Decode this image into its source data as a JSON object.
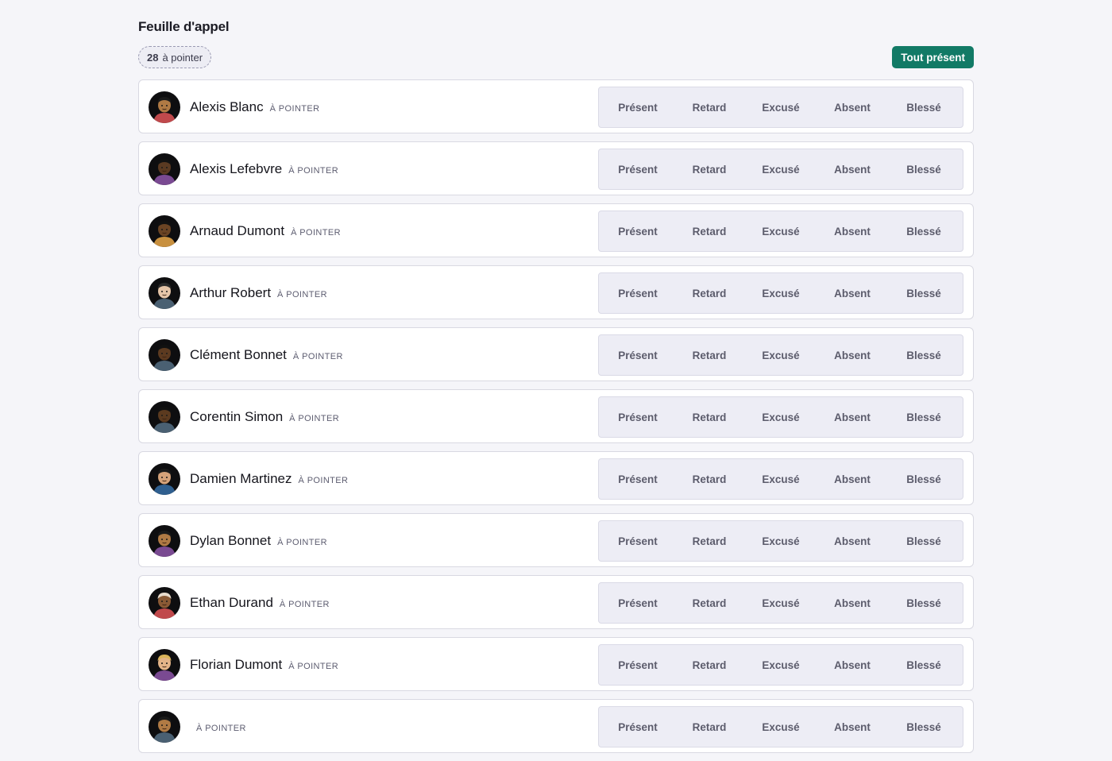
{
  "header": {
    "title": "Feuille d'appel",
    "count": "28",
    "count_label": "à pointer",
    "all_present_label": "Tout présent"
  },
  "status_options": [
    "Présent",
    "Retard",
    "Excusé",
    "Absent",
    "Blessé"
  ],
  "pending_tag": "À POINTER",
  "players": [
    {
      "name": "Alexis Blanc",
      "skin": "#b07a44",
      "shirt": "#c0494c",
      "hair": "#1a1a1a"
    },
    {
      "name": "Alexis Lefebvre",
      "skin": "#5a3a22",
      "shirt": "#7a4a92",
      "hair": "#111111"
    },
    {
      "name": "Arnaud Dumont",
      "skin": "#6b4424",
      "shirt": "#c8903f",
      "hair": "#111111"
    },
    {
      "name": "Arthur Robert",
      "skin": "#e6c5a8",
      "shirt": "#4a6072",
      "hair": "#2a2a2a"
    },
    {
      "name": "Clément Bonnet",
      "skin": "#5c3a20",
      "shirt": "#4a6072",
      "hair": "#111111"
    },
    {
      "name": "Corentin Simon",
      "skin": "#5b3a1f",
      "shirt": "#4a6072",
      "hair": "#111111"
    },
    {
      "name": "Damien Martinez",
      "skin": "#d6a37a",
      "shirt": "#2f5f8f",
      "hair": "#1a1a1a"
    },
    {
      "name": "Dylan Bonnet",
      "skin": "#b07a44",
      "shirt": "#7a4a92",
      "hair": "#1a1a1a"
    },
    {
      "name": "Ethan Durand",
      "skin": "#8a5a35",
      "shirt": "#c0494c",
      "hair": "#e8dccc"
    },
    {
      "name": "Florian Dumont",
      "skin": "#e3b488",
      "shirt": "#7a4a92",
      "hair": "#d9b45a"
    },
    {
      "name": "",
      "skin": "#b07a44",
      "shirt": "#4a6072",
      "hair": "#1a1a1a"
    }
  ]
}
